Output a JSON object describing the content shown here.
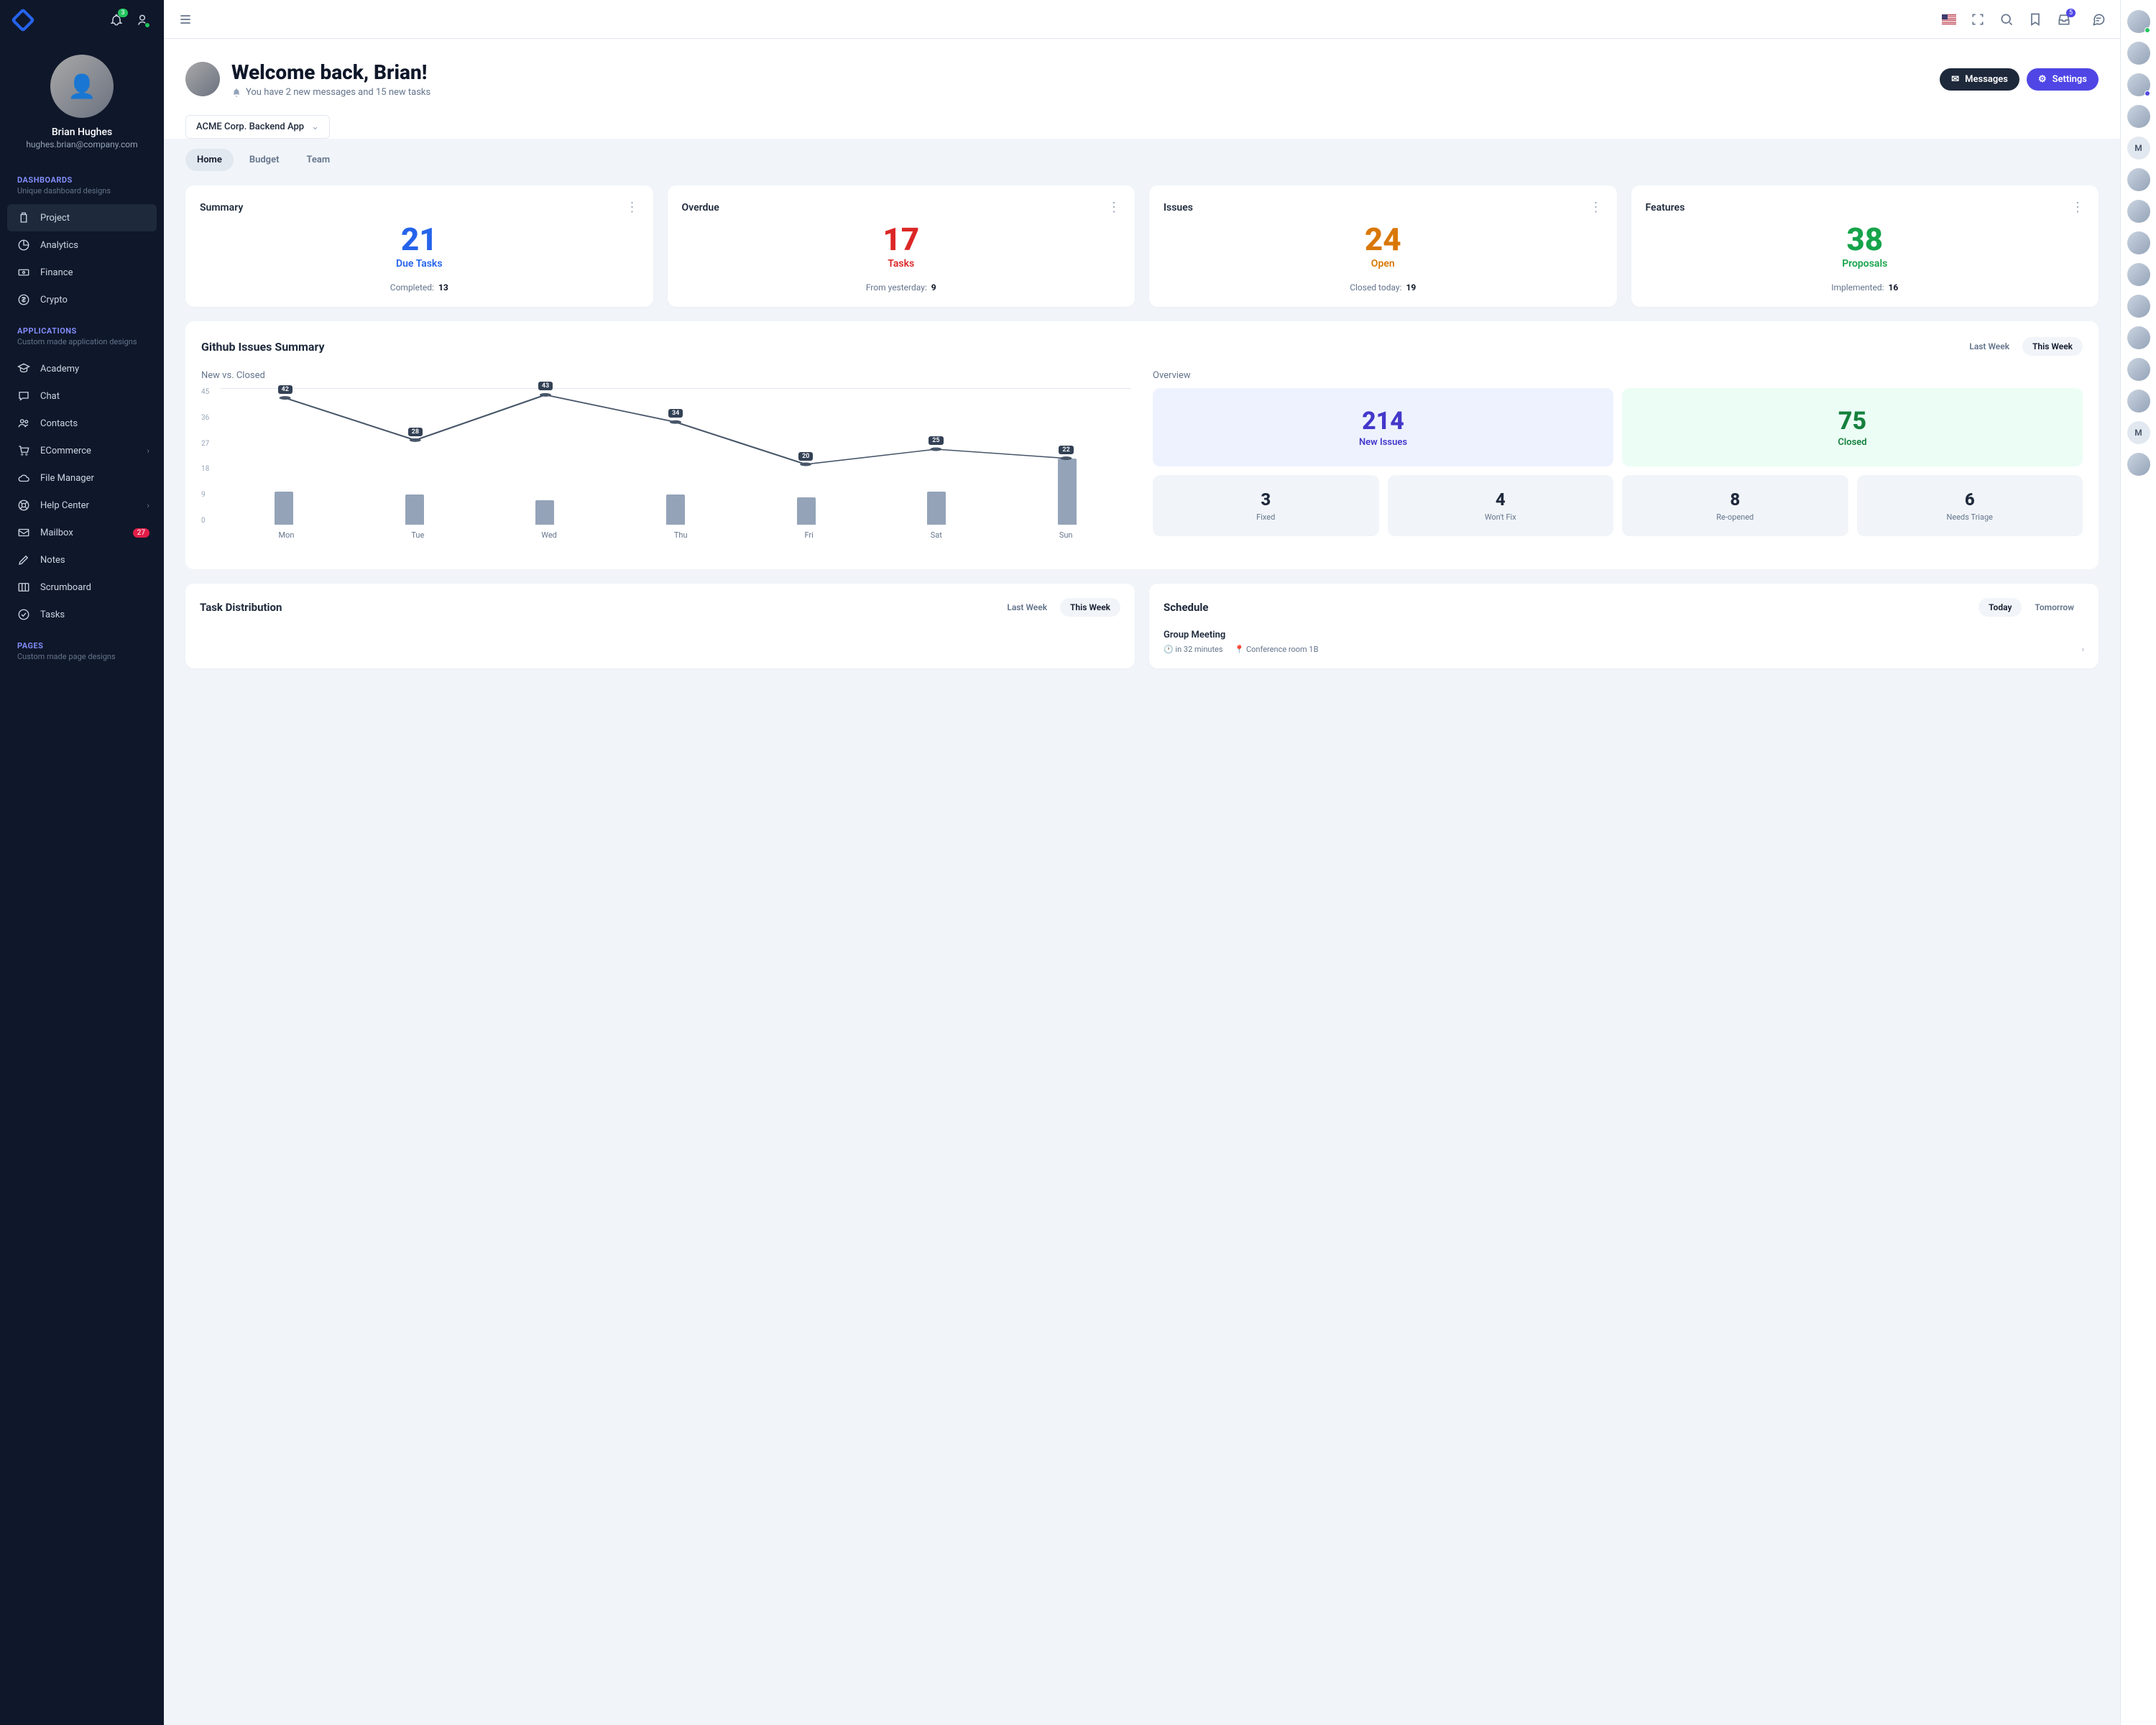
{
  "sidebar": {
    "notificationBadge": "3",
    "user": {
      "name": "Brian Hughes",
      "email": "hughes.brian@company.com"
    },
    "groups": [
      {
        "title": "DASHBOARDS",
        "subtitle": "Unique dashboard designs",
        "items": [
          {
            "label": "Project",
            "icon": "clipboard",
            "active": true
          },
          {
            "label": "Analytics",
            "icon": "pie"
          },
          {
            "label": "Finance",
            "icon": "cash"
          },
          {
            "label": "Crypto",
            "icon": "dollar"
          }
        ]
      },
      {
        "title": "APPLICATIONS",
        "subtitle": "Custom made application designs",
        "items": [
          {
            "label": "Academy",
            "icon": "academic"
          },
          {
            "label": "Chat",
            "icon": "chat"
          },
          {
            "label": "Contacts",
            "icon": "users"
          },
          {
            "label": "ECommerce",
            "icon": "cart",
            "expandable": true
          },
          {
            "label": "File Manager",
            "icon": "cloud"
          },
          {
            "label": "Help Center",
            "icon": "support",
            "expandable": true
          },
          {
            "label": "Mailbox",
            "icon": "mail",
            "badge": "27"
          },
          {
            "label": "Notes",
            "icon": "pencil"
          },
          {
            "label": "Scrumboard",
            "icon": "board"
          },
          {
            "label": "Tasks",
            "icon": "check"
          }
        ]
      },
      {
        "title": "PAGES",
        "subtitle": "Custom made page designs",
        "items": []
      }
    ]
  },
  "topbar": {
    "inboxBadge": "5"
  },
  "header": {
    "title": "Welcome back, Brian!",
    "subtitle": "You have 2 new messages and 15 new tasks",
    "messagesBtn": "Messages",
    "settingsBtn": "Settings",
    "project": "ACME Corp. Backend App"
  },
  "tabs": [
    "Home",
    "Budget",
    "Team"
  ],
  "activeTab": 0,
  "stats": [
    {
      "title": "Summary",
      "value": "21",
      "label": "Due Tasks",
      "footer": "Completed:",
      "footerVal": "13",
      "color": "blue"
    },
    {
      "title": "Overdue",
      "value": "17",
      "label": "Tasks",
      "footer": "From yesterday:",
      "footerVal": "9",
      "color": "red"
    },
    {
      "title": "Issues",
      "value": "24",
      "label": "Open",
      "footer": "Closed today:",
      "footerVal": "19",
      "color": "amber"
    },
    {
      "title": "Features",
      "value": "38",
      "label": "Proposals",
      "footer": "Implemented:",
      "footerVal": "16",
      "color": "green"
    }
  ],
  "github": {
    "title": "Github Issues Summary",
    "timeOpts": [
      "Last Week",
      "This Week"
    ],
    "activeTime": 1,
    "chartTitle": "New vs. Closed",
    "overviewTitle": "Overview",
    "bigStats": [
      {
        "val": "214",
        "label": "New Issues",
        "class": "indigo"
      },
      {
        "val": "75",
        "label": "Closed",
        "class": "darkgreen"
      }
    ],
    "smallStats": [
      {
        "val": "3",
        "label": "Fixed"
      },
      {
        "val": "4",
        "label": "Won't Fix"
      },
      {
        "val": "8",
        "label": "Re-opened"
      },
      {
        "val": "6",
        "label": "Needs Triage"
      }
    ]
  },
  "chart_data": {
    "type": "bar+line",
    "title": "New vs. Closed",
    "categories": [
      "Mon",
      "Tue",
      "Wed",
      "Thu",
      "Fri",
      "Sat",
      "Sun"
    ],
    "y_ticks": [
      0,
      9,
      18,
      27,
      36,
      45
    ],
    "series": [
      {
        "name": "line",
        "values": [
          42,
          28,
          43,
          34,
          20,
          25,
          22
        ]
      },
      {
        "name": "bar",
        "values": [
          11,
          10,
          8,
          10,
          9,
          11,
          22
        ]
      }
    ]
  },
  "taskDist": {
    "title": "Task Distribution",
    "timeOpts": [
      "Last Week",
      "This Week"
    ],
    "activeTime": 1
  },
  "schedule": {
    "title": "Schedule",
    "timeOpts": [
      "Today",
      "Tomorrow"
    ],
    "activeTime": 0,
    "items": [
      {
        "title": "Group Meeting",
        "time": "in 32 minutes",
        "location": "Conference room 1B"
      }
    ]
  },
  "quickpanel": [
    {
      "initial": "",
      "dot": "#22c55e"
    },
    {
      "initial": ""
    },
    {
      "initial": "",
      "dot": "#4f46e5"
    },
    {
      "initial": ""
    },
    {
      "initial": "M",
      "letter": true
    },
    {
      "initial": ""
    },
    {
      "initial": ""
    },
    {
      "initial": ""
    },
    {
      "initial": ""
    },
    {
      "initial": ""
    },
    {
      "initial": ""
    },
    {
      "initial": ""
    },
    {
      "initial": ""
    },
    {
      "initial": "M",
      "letter": true
    },
    {
      "initial": ""
    }
  ]
}
